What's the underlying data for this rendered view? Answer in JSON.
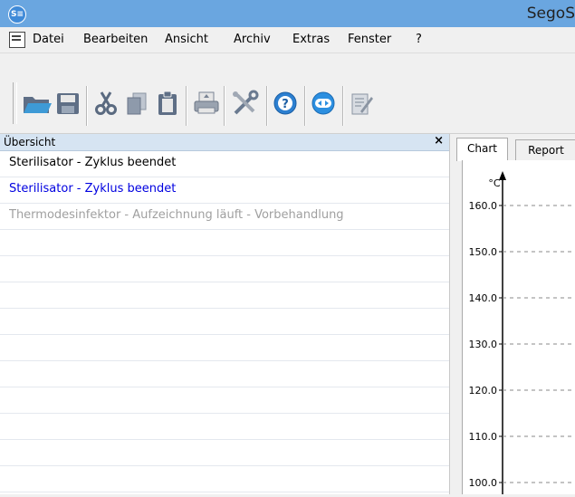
{
  "window": {
    "title": "SegoS"
  },
  "menu": {
    "items": [
      "Datei",
      "Bearbeiten",
      "Ansicht",
      "Archiv",
      "Extras",
      "Fenster",
      "?"
    ]
  },
  "toolbar": {
    "icons": [
      "open-folder-icon",
      "save-icon",
      "cut-icon",
      "copy-icon",
      "paste-icon",
      "print-icon",
      "tools-icon",
      "help-icon",
      "remote-icon",
      "edit-document-icon"
    ]
  },
  "overview": {
    "title": "Übersicht",
    "close": "×",
    "rows": [
      {
        "label": "Sterilisator - Zyklus beendet",
        "color": "#000000"
      },
      {
        "label": "Sterilisator - Zyklus beendet",
        "color": "#0000e0"
      },
      {
        "label": "Thermodesinfektor - Aufzeichnung läuft - Vorbehandlung",
        "color": "#a0a0a0"
      },
      {
        "label": ""
      },
      {
        "label": ""
      },
      {
        "label": ""
      },
      {
        "label": ""
      },
      {
        "label": ""
      },
      {
        "label": ""
      },
      {
        "label": ""
      },
      {
        "label": ""
      },
      {
        "label": ""
      },
      {
        "label": ""
      }
    ]
  },
  "tabs": [
    "Chart",
    "Report"
  ],
  "chart_data": {
    "type": "line",
    "ylabel": "°C",
    "yticks": [
      "160.0",
      "150.0",
      "140.0",
      "130.0",
      "120.0",
      "110.0",
      "100.0"
    ],
    "ylim": [
      100,
      160
    ],
    "grid": true,
    "series": []
  }
}
